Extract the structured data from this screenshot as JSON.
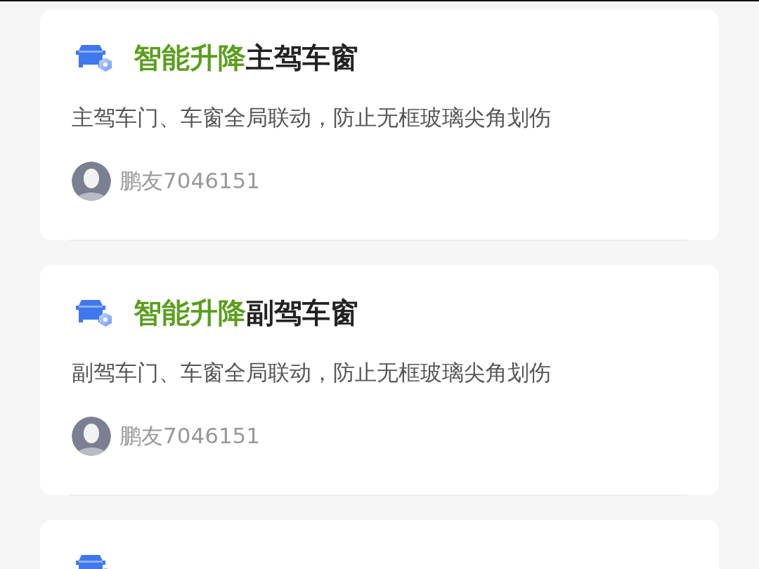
{
  "cards": [
    {
      "kind": "post",
      "title_highlight": "智能升降",
      "title_rest": "主驾车窗",
      "description": "主驾车门、车窗全局联动，防止无框玻璃尖角划伤",
      "author": "鹏友7046151"
    },
    {
      "kind": "post",
      "title_highlight": "智能升降",
      "title_rest": "副驾车窗",
      "description": "副驾车门、车窗全局联动，防止无框玻璃尖角划伤",
      "author": "鹏友7046151"
    },
    {
      "kind": "cut"
    }
  ]
}
